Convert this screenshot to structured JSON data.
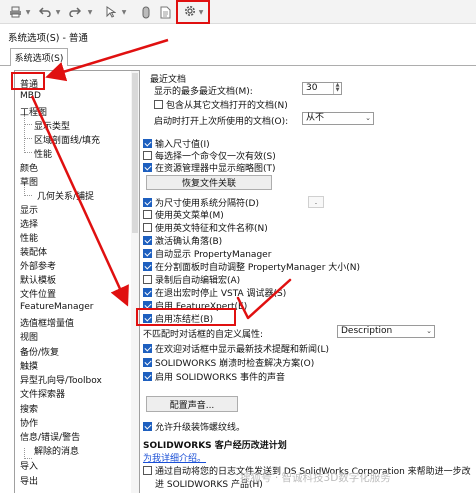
{
  "toolbar": {
    "buttons": [
      "print-icon",
      "undo-icon",
      "redo-icon",
      "select-pointer-icon",
      "rebuild-icon",
      "file-properties-icon",
      "options-gear-icon"
    ]
  },
  "dialog": {
    "title": "系统选项(S) - 普通",
    "tab": "系统选项(S)"
  },
  "categories": [
    {
      "label": "普通",
      "selected": true
    },
    {
      "label": "MBD"
    },
    {
      "label": "工程图"
    },
    {
      "label": "显示类型",
      "level": 1
    },
    {
      "label": "区域剖面线/填充",
      "level": 1
    },
    {
      "label": "性能",
      "level": 1
    },
    {
      "label": "颜色"
    },
    {
      "label": "草图"
    },
    {
      "label": "几何关系/捕捉",
      "level": 1
    },
    {
      "label": "显示"
    },
    {
      "label": "选择"
    },
    {
      "label": "性能"
    },
    {
      "label": "装配体"
    },
    {
      "label": "外部参考"
    },
    {
      "label": "默认模板"
    },
    {
      "label": "文件位置"
    },
    {
      "label": "FeatureManager"
    },
    {
      "label": "选值框增量值"
    },
    {
      "label": "视图"
    },
    {
      "label": "备份/恢复"
    },
    {
      "label": "触摸"
    },
    {
      "label": "异型孔向导/Toolbox"
    },
    {
      "label": "文件探索器"
    },
    {
      "label": "搜索"
    },
    {
      "label": "协作"
    },
    {
      "label": "信息/错误/警告"
    },
    {
      "label": "解除的消息",
      "level": 1
    },
    {
      "label": "导入"
    },
    {
      "label": "导出"
    }
  ],
  "options": {
    "recent_docs_group": "最近文档",
    "max_recent_label": "显示的最多最近文档(M):",
    "max_recent_value": "30",
    "include_other_sessions": "包含从其它文档打开的文档(N)",
    "open_last_used_label": "启动时打开上次所使用的文档(O):",
    "open_last_used_value": "从不",
    "input_dimension": "输入尺寸值(I)",
    "single_command": "每选择一个命令仅一次有效(S)",
    "show_thumbnails": "在资源管理器中显示缩略图(T)",
    "restore_assoc_button": "恢复文件关联",
    "use_system_separator": "为尺寸使用系统分隔符(D)",
    "system_separator_value": ".",
    "use_english_menu": "使用英文菜单(M)",
    "use_english_feature_names": "使用英文特征和文件名称(N)",
    "activate_confirm_corner": "激活确认角落(B)",
    "auto_show_pm": "自动显示 PropertyManager",
    "auto_resize_pm": "在分割面板时自动调整 PropertyManager 大小(N)",
    "auto_edit_macro": "录制后自动编辑宏(A)",
    "stop_vsta": "在退出宏时停止 VSTA 调试器(S)",
    "enable_featurexpert": "启用 FeatureXpert(E)",
    "enable_freeze_bar": "启用冻结栏(B)",
    "no_match_label": "不匹配时对话框的自定义属性:",
    "no_match_value": "Description",
    "show_latest_tech": "在欢迎对话框中显示最新技术提醒和新闻(L)",
    "crash_solutions": "SOLIDWORKS 崩溃时检查解决方案(O)",
    "enable_event_sounds": "启用 SOLIDWORKS 事件的声音",
    "configure_sounds_button": "配置声音...",
    "allow_upgrade_textures": "允许升级装饰螺纹线。",
    "cep_heading": "SOLIDWORKS 客户经历改进计划",
    "more_info_link": "为我详细介绍。",
    "cep_text_line1": "通过自动将您的日志文件发送到 DS SolidWorks Corporation 来帮助进一步改",
    "cep_text_line2": "进 SOLIDWORKS 产品(H)"
  },
  "checkbox_states": {
    "include_other_sessions": false,
    "input_dimension": true,
    "single_command": false,
    "show_thumbnails": true,
    "use_system_separator": true,
    "use_english_menu": false,
    "use_english_feature_names": false,
    "activate_confirm_corner": true,
    "auto_show_pm": true,
    "auto_resize_pm": true,
    "auto_edit_macro": false,
    "stop_vsta": true,
    "enable_featurexpert": true,
    "enable_freeze_bar": true,
    "show_latest_tech": true,
    "crash_solutions": true,
    "enable_event_sounds": true,
    "allow_upgrade_textures": true,
    "cep_participate": false
  },
  "watermark": "搜狐号 · 智诚科技3D数字化服务",
  "colors": {
    "annotation": "#e01010",
    "checkbox_on": "#1d5fbf",
    "link": "#1a4fd6"
  }
}
